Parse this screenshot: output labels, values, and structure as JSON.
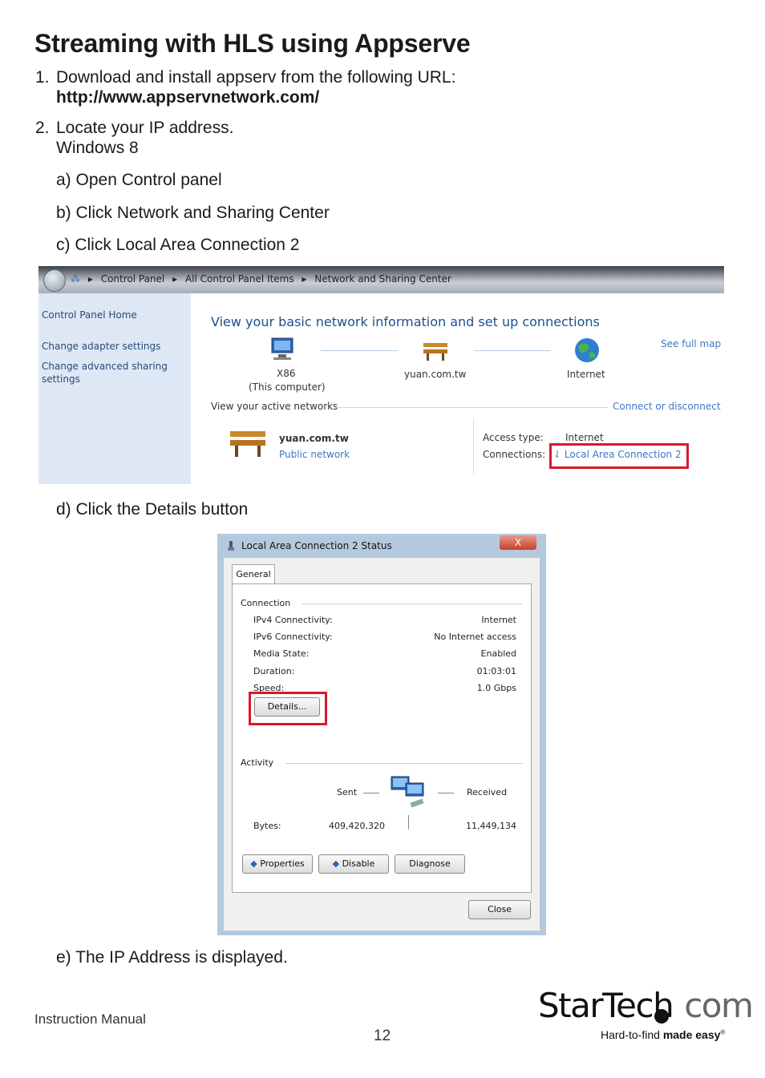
{
  "heading": "Streaming with HLS using Appserve",
  "steps": {
    "s1_num": "1.",
    "s1_text": "Download and install appserv from the following URL:",
    "s1_url": "http://www.appservnetwork.com/",
    "s2_num": "2.",
    "s2_text": "Locate your IP address.",
    "s2_os": "Windows 8",
    "a": "a)  Open Control panel",
    "b": "b)  Click Network and Sharing Center",
    "c": "c)  Click Local Area Connection 2",
    "d": "d)  Click the Details button",
    "e": "e)  The IP Address is displayed."
  },
  "control_panel": {
    "crumbs": [
      "Control Panel",
      "All Control Panel Items",
      "Network and Sharing Center"
    ],
    "sidebar": [
      "Control Panel Home",
      "Change adapter settings",
      "Change advanced sharing",
      "settings"
    ],
    "title": "View your basic network information and set up connections",
    "see_full_map": "See full map",
    "node1": "X86",
    "node1_sub": "(This computer)",
    "node2": "yuan.com.tw",
    "node3": "Internet",
    "active_networks": "View your active networks",
    "connect": "Connect or disconnect",
    "network_name": "yuan.com.tw",
    "network_type": "Public network",
    "access_type_label": "Access type:",
    "access_type_value": "Internet",
    "connections_label": "Connections:",
    "connections_value": "Local Area Connection 2"
  },
  "status_dialog": {
    "title": "Local Area Connection 2 Status",
    "close_x": "X",
    "tab": "General",
    "connection_group": "Connection",
    "rows": [
      {
        "label": "IPv4 Connectivity:",
        "value": "Internet"
      },
      {
        "label": "IPv6 Connectivity:",
        "value": "No Internet access"
      },
      {
        "label": "Media State:",
        "value": "Enabled"
      },
      {
        "label": "Duration:",
        "value": "01:03:01"
      },
      {
        "label": "Speed:",
        "value": "1.0 Gbps"
      }
    ],
    "details_button": "Details...",
    "activity_group": "Activity",
    "sent": "Sent",
    "received": "Received",
    "bytes_label": "Bytes:",
    "bytes_sent": "409,420,320",
    "bytes_received": "11,449,134",
    "properties_button": "Properties",
    "disable_button": "Disable",
    "diagnose_button": "Diagnose",
    "close_button": "Close"
  },
  "footer": {
    "manual": "Instruction Manual",
    "page": "12",
    "logo_main": "StarTech",
    "logo_com": "com",
    "tag_plain": "Hard-to-find ",
    "tag_bold": "made easy",
    "tag_reg": "®"
  },
  "colors": {
    "highlight_red": "#d9182a",
    "link_blue": "#3b77c4"
  }
}
